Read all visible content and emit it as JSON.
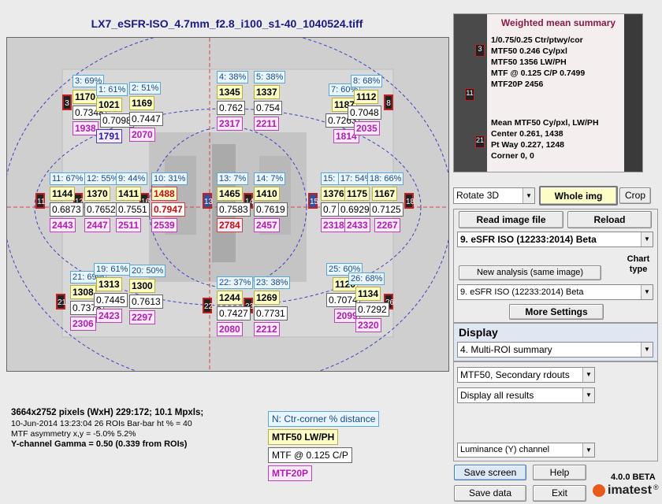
{
  "window": {
    "title": "LX7_eSFR-ISO_4.7mm_f2.8_i100_s1-40_1040524.tiff"
  },
  "rois": [
    {
      "id": "3",
      "label": "3: 69%",
      "mtf50": "1170",
      "mtfc": "0.7348",
      "mtf20": "1938"
    },
    {
      "id": "1",
      "label": "1: 61%",
      "mtf50": "1021",
      "mtfc": "0.7098",
      "mtf20": "1791"
    },
    {
      "id": "2",
      "label": "2: 51%",
      "mtf50": "1169",
      "mtfc": "0.7447",
      "mtf20": "2070"
    },
    {
      "id": "4",
      "label": "4: 38%",
      "mtf50": "1345",
      "mtfc": "0.762",
      "mtf20": "2317"
    },
    {
      "id": "5",
      "label": "5: 38%",
      "mtf50": "1337",
      "mtfc": "0.754",
      "mtf20": "2211"
    },
    {
      "id": "7",
      "label": "7: 60%",
      "mtf50": "1187",
      "mtfc": "0.7263",
      "mtf20": "1814"
    },
    {
      "id": "8",
      "label": "8: 68%",
      "mtf50": "1112",
      "mtfc": "0.7048",
      "mtf20": "2035"
    },
    {
      "id": "11",
      "label": "11: 67%",
      "mtf50": "1144",
      "mtfc": "0.6873",
      "mtf20": "2443"
    },
    {
      "id": "12",
      "label": "12: 55%",
      "mtf50": "1370",
      "mtfc": "0.7652",
      "mtf20": "2447"
    },
    {
      "id": "9",
      "label": "9: 44%",
      "mtf50": "1411",
      "mtfc": "0.7551",
      "mtf20": "2511"
    },
    {
      "id": "10",
      "label": "10: 31%",
      "mtf50": "1488",
      "mtfc": "0.7947",
      "mtf20": "2539"
    },
    {
      "id": "13",
      "label": "13: 7%",
      "mtf50": "1465",
      "mtfc": "0.7583",
      "mtf20": "2784"
    },
    {
      "id": "14",
      "label": "14: 7%",
      "mtf50": "1410",
      "mtfc": "0.7619",
      "mtf20": "2457"
    },
    {
      "id": "15",
      "label": "15: 17%",
      "mtf50": "1376",
      "mtfc": "0.7",
      "mtf20": "2318"
    },
    {
      "id": "17",
      "label": "17: 54%",
      "mtf50": "1175",
      "mtfc": "0.6929",
      "mtf20": "2433"
    },
    {
      "id": "18",
      "label": "18: 66%",
      "mtf50": "1167",
      "mtfc": "0.7125",
      "mtf20": "2267"
    },
    {
      "id": "21",
      "label": "21: 69%",
      "mtf50": "1308",
      "mtfc": "0.7378",
      "mtf20": "2306"
    },
    {
      "id": "19",
      "label": "19: 61%",
      "mtf50": "1313",
      "mtfc": "0.7445",
      "mtf20": "2423"
    },
    {
      "id": "20",
      "label": "20: 50%",
      "mtf50": "1300",
      "mtfc": "0.7613",
      "mtf20": "2297"
    },
    {
      "id": "22",
      "label": "22: 37%",
      "mtf50": "1244",
      "mtfc": "0.7427",
      "mtf20": "2080"
    },
    {
      "id": "23",
      "label": "23: 38%",
      "mtf50": "1269",
      "mtfc": "0.7731",
      "mtf20": "2212"
    },
    {
      "id": "25",
      "label": "25: 60%",
      "mtf50": "1120",
      "mtfc": "0.7074",
      "mtf20": "2099"
    },
    {
      "id": "26",
      "label": "26: 68%",
      "mtf50": "1134",
      "mtfc": "0.7292",
      "mtf20": "2320"
    }
  ],
  "roi_tags": [
    "3",
    "8",
    "11",
    "12",
    "13",
    "14",
    "15",
    "16",
    "18",
    "21",
    "22",
    "23",
    "26"
  ],
  "summary": {
    "title": "Weighted mean summary",
    "lines": [
      "1/0.75/0.25 Ctr/ptwy/cor",
      "MTF50  0.246 Cy/pxl",
      "MTF50  1356 LW/PH",
      "MTF @ 0.125 C/P  0.7499",
      "MTF20P  2456",
      "",
      "Mean MTF50 Cy/pxl, LW/PH",
      "Center  0.261,  1438",
      "Pt Way  0.227,  1248",
      "Corner  0,  0"
    ],
    "thumb_marks": [
      "3",
      "11",
      "21"
    ]
  },
  "controls": {
    "rotate": "Rotate 3D",
    "whole_img": "Whole img",
    "crop": "Crop",
    "read_image": "Read image file",
    "reload": "Reload",
    "module": "9. eSFR ISO  (12233:2014)  Beta",
    "chart_type_label": "Chart type",
    "new_analysis": "New analysis (same image)",
    "chart_select": "9. eSFR ISO  (12233:2014)  Beta",
    "more_settings": "More Settings",
    "display_label": "Display",
    "display_select": "4.  Multi-ROI summary",
    "secondary_select": "MTF50, Secondary rdouts",
    "results_select": "Display all results",
    "channel_select": "Luminance (Y) channel",
    "save_screen": "Save screen",
    "help": "Help",
    "save_data": "Save data",
    "exit": "Exit",
    "version": "4.0.0 BETA",
    "brand": "imatest",
    "brand_mark": "®"
  },
  "info": {
    "line1": "3664x2752 pixels (WxH) 229:172;   10.1 Mpxls;",
    "line2": "10-Jun-2014 13:23:04   26 ROIs   Bar-bar ht % = 40",
    "line3": "MTF asymmetry x,y = -5.0%  5.2%",
    "line4": "Y-channel    Gamma = 0.50  (0.339 from ROIs)"
  },
  "legend": {
    "label": "N:  Ctr-corner % distance",
    "mtf50": "MTF50  LW/PH",
    "mtfc": "MTF @ 0.125 C/P",
    "mtf20": "MTF20P"
  },
  "colors": {
    "accent": "#8a1a4a",
    "highlight": "#c01010",
    "title": "#1a1a80"
  }
}
